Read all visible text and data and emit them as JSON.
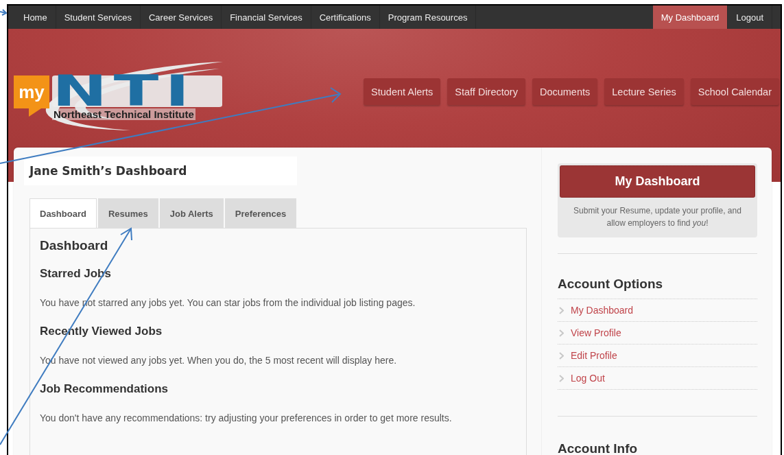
{
  "top_nav": {
    "items": [
      {
        "label": "Home",
        "selected": false
      },
      {
        "label": "Student Services",
        "selected": false
      },
      {
        "label": "Career Services",
        "selected": false
      },
      {
        "label": "Financial Services",
        "selected": false
      },
      {
        "label": "Certifications",
        "selected": false
      },
      {
        "label": "Program Resources",
        "selected": false
      }
    ],
    "right_items": [
      {
        "label": "My Dashboard",
        "selected": true
      },
      {
        "label": "Logout",
        "selected": false
      }
    ]
  },
  "logo": {
    "badge": "my",
    "name": "NTI",
    "tagline": "Northeast Technical Institute"
  },
  "header_buttons": [
    "Student Alerts",
    "Staff Directory",
    "Documents",
    "Lecture Series",
    "School Calendar"
  ],
  "main": {
    "title": "Jane Smith’s Dashboard",
    "tabs": [
      {
        "label": "Dashboard",
        "selected": true
      },
      {
        "label": "Resumes",
        "selected": false
      },
      {
        "label": "Job Alerts",
        "selected": false
      },
      {
        "label": "Preferences",
        "selected": false
      }
    ],
    "heading": "Dashboard",
    "sections": [
      {
        "heading": "Starred Jobs",
        "text": "You have not starred any jobs yet. You can star jobs from the individual job listing pages."
      },
      {
        "heading": "Recently Viewed Jobs",
        "text": "You have not viewed any jobs yet. When you do, the 5 most recent will display here."
      },
      {
        "heading": "Job Recommendations",
        "text": "You don't have any recommendations: try adjusting your preferences in order to get more results."
      }
    ]
  },
  "sidebar": {
    "button": "My Dashboard",
    "blurb": "Submit your Resume, update your profile, and allow employers to find *you*!",
    "options_title": "Account Options",
    "links": [
      "My Dashboard",
      "View Profile",
      "Edit Profile",
      "Log Out"
    ],
    "info_title": "Account Info"
  }
}
